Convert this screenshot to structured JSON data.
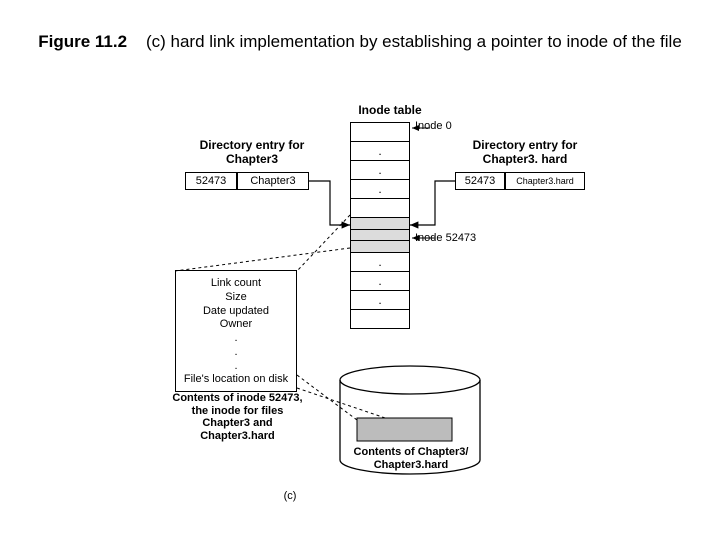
{
  "title_bold": "Figure 11.2",
  "title_rest": "(c) hard link implementation by establishing a pointer  to inode of the file",
  "inode_table_label": "Inode table",
  "inode_0_label": "Inode 0",
  "inode_52473_label": "Inode 52473",
  "left_dir": {
    "heading_l1": "Directory entry for",
    "heading_l2": "Chapter3",
    "inode_num": "52473",
    "filename": "Chapter3"
  },
  "right_dir": {
    "heading_l1": "Directory entry for",
    "heading_l2": "Chapter3. hard",
    "inode_num": "52473",
    "filename": "Chapter3.hard"
  },
  "inode_contents": {
    "lines": [
      "Link count",
      "Size",
      "Date updated",
      "Owner"
    ],
    "dots": [
      ".",
      ".",
      "."
    ],
    "last": "File's location on disk"
  },
  "inode_caption_l1": "Contents of inode 52473,",
  "inode_caption_l2": "the inode for files",
  "inode_caption_l3": "Chapter3 and",
  "inode_caption_l4": "Chapter3.hard",
  "disk_caption_l1": "Contents of Chapter3/",
  "disk_caption_l2": "Chapter3.hard",
  "subfig": "(c)"
}
